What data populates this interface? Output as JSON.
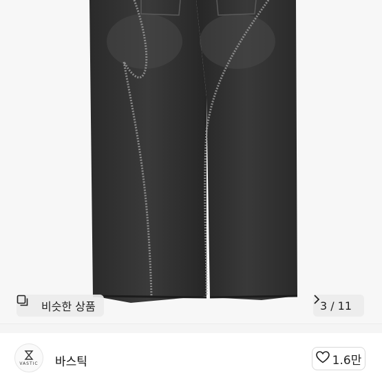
{
  "product_image": {
    "alt": "black denim jeans",
    "background_color": "#f7f7f7",
    "denim_color": "#2e2e2e"
  },
  "similar_button": {
    "label": "비슷한 상품",
    "icon": "similar-items-icon"
  },
  "image_counter": {
    "text": "3 / 11",
    "icon": "chevron-right-icon"
  },
  "seller": {
    "name": "바스틱",
    "avatar_brand": "VASTIC",
    "like_count": "1.6만",
    "like_icon": "heart-outline-icon"
  }
}
